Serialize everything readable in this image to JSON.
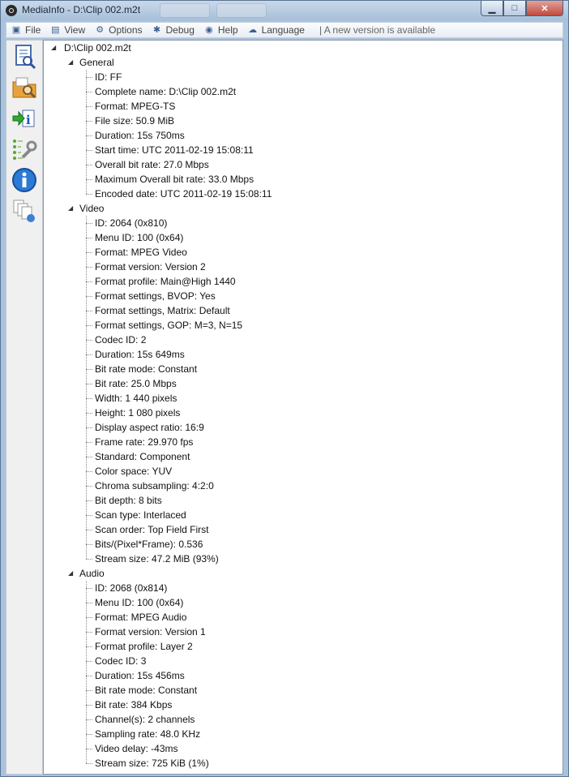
{
  "window": {
    "title": "MediaInfo - D:\\Clip 002.m2t",
    "controls": {
      "minimize": "▁",
      "maximize": "□",
      "close": "✕"
    }
  },
  "menu": {
    "items": [
      {
        "label": "File",
        "icon": "file-icon"
      },
      {
        "label": "View",
        "icon": "view-icon"
      },
      {
        "label": "Options",
        "icon": "options-icon"
      },
      {
        "label": "Debug",
        "icon": "debug-icon"
      },
      {
        "label": "Help",
        "icon": "help-icon"
      },
      {
        "label": "Language",
        "icon": "language-icon"
      }
    ],
    "notice": "| A new version is available"
  },
  "toolbar": {
    "icons": [
      "open-file-icon",
      "open-folder-icon",
      "export-icon",
      "preferences-icon",
      "about-icon",
      "sheet-icon"
    ]
  },
  "tree": {
    "root": "D:\\Clip 002.m2t",
    "sections": [
      {
        "name": "General",
        "items": [
          "ID: FF",
          "Complete name: D:\\Clip 002.m2t",
          "Format: MPEG-TS",
          "File size: 50.9 MiB",
          "Duration: 15s 750ms",
          "Start time: UTC 2011-02-19 15:08:11",
          "Overall bit rate: 27.0 Mbps",
          "Maximum Overall bit rate: 33.0 Mbps",
          "Encoded date: UTC 2011-02-19 15:08:11"
        ]
      },
      {
        "name": "Video",
        "items": [
          "ID: 2064 (0x810)",
          "Menu ID: 100 (0x64)",
          "Format: MPEG Video",
          "Format version: Version 2",
          "Format profile: Main@High 1440",
          "Format settings, BVOP: Yes",
          "Format settings, Matrix: Default",
          "Format settings, GOP: M=3, N=15",
          "Codec ID: 2",
          "Duration: 15s 649ms",
          "Bit rate mode: Constant",
          "Bit rate: 25.0 Mbps",
          "Width: 1 440 pixels",
          "Height: 1 080 pixels",
          "Display aspect ratio: 16:9",
          "Frame rate: 29.970 fps",
          "Standard: Component",
          "Color space: YUV",
          "Chroma subsampling: 4:2:0",
          "Bit depth: 8 bits",
          "Scan type: Interlaced",
          "Scan order: Top Field First",
          "Bits/(Pixel*Frame): 0.536",
          "Stream size: 47.2 MiB (93%)"
        ]
      },
      {
        "name": "Audio",
        "items": [
          "ID: 2068 (0x814)",
          "Menu ID: 100 (0x64)",
          "Format: MPEG Audio",
          "Format version: Version 1",
          "Format profile: Layer 2",
          "Codec ID: 3",
          "Duration: 15s 456ms",
          "Bit rate mode: Constant",
          "Bit rate: 384 Kbps",
          "Channel(s): 2 channels",
          "Sampling rate: 48.0 KHz",
          "Video delay: -43ms",
          "Stream size: 725 KiB (1%)"
        ]
      }
    ]
  }
}
